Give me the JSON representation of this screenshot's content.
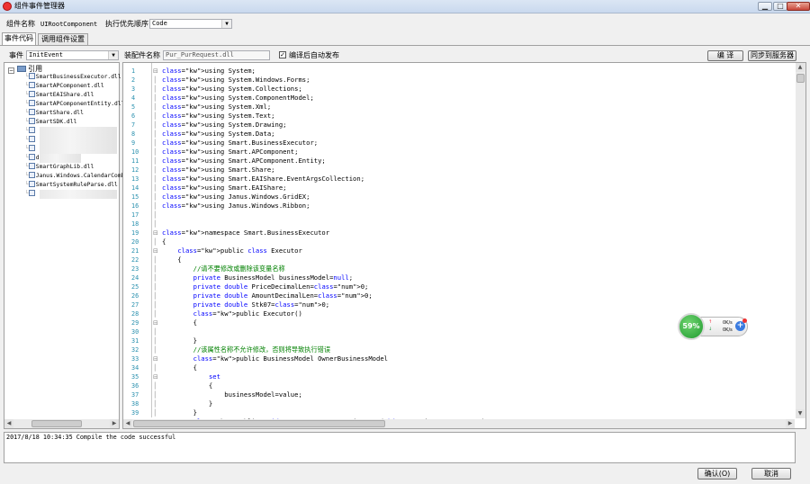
{
  "window": {
    "title": "组件事件管理器",
    "min": "▁",
    "max": "□",
    "close": "✕"
  },
  "header": {
    "component_label": "组件名称",
    "component_value": "UIRootComponent",
    "priority_label": "执行优先顺序",
    "priority_value": "Code"
  },
  "tabs": [
    {
      "label": "事件代码"
    },
    {
      "label": "调用组件设置"
    }
  ],
  "toolbar": {
    "event_label": "事件",
    "event_value": "InitEvent",
    "assembly_label": "装配件名称",
    "assembly_value": "Pur_PurRequest.dll",
    "autopublish_label": "编译后自动发布",
    "autopublish_checked": true,
    "compile_button": "编 译",
    "sync_button": "同步到服务器"
  },
  "tree": {
    "root": "引用",
    "items": [
      "SmartBusinessExecutor.dll",
      "SmartAPComponent.dll",
      "SmartEAIShare.dll",
      "SmartAPComponentEntity.dll",
      "SmartShare.dll",
      "SmartSDK.dll",
      "",
      "",
      "",
      "dll",
      "SmartGraphLib.dll",
      "Janus.Windows.CalendarCombo.dll",
      "SmartSystemRuleParse.dll",
      ""
    ]
  },
  "code_lines": [
    "using System;",
    "using System.Windows.Forms;",
    "using System.Collections;",
    "using System.ComponentModel;",
    "using System.Xml;",
    "using System.Text;",
    "using System.Drawing;",
    "using System.Data;",
    "using Smart.BusinessExecutor;",
    "using Smart.APComponent;",
    "using Smart.APComponent.Entity;",
    "using Smart.Share;",
    "using Smart.EAIShare.EventArgsCollection;",
    "using Smart.EAIShare;",
    "using Janus.Windows.GridEX;",
    "using Janus.Windows.Ribbon;",
    "",
    "",
    "namespace Smart.BusinessExecutor",
    "{",
    "    public class Executor",
    "    {",
    "        //请不要修改或删除该变量名称",
    "        private BusinessModel businessModel=null;",
    "        private double PriceDecimalLen=0;",
    "        private double AmountDecimalLen=0;",
    "        private double Stk07=0;",
    "        public Executor()",
    "        {",
    "",
    "        }",
    "        //该属性名称不允许修改，否则将导致执行错误",
    "        public BusinessModel OwnerBusinessModel",
    "        {",
    "            set",
    "            {",
    "                businessModel=value;",
    "            }",
    "        }",
    "        public void UIRootComponent_InitEvent(object sender,EventArgs e)"
  ],
  "console": {
    "text": "2017/8/18 10:34:35 Compile the code successful"
  },
  "footer": {
    "ok_button": "确认(O)",
    "cancel_button": "取消"
  },
  "net_widget": {
    "percent": "59%",
    "upload": "0K/s",
    "download": "0K/s"
  }
}
